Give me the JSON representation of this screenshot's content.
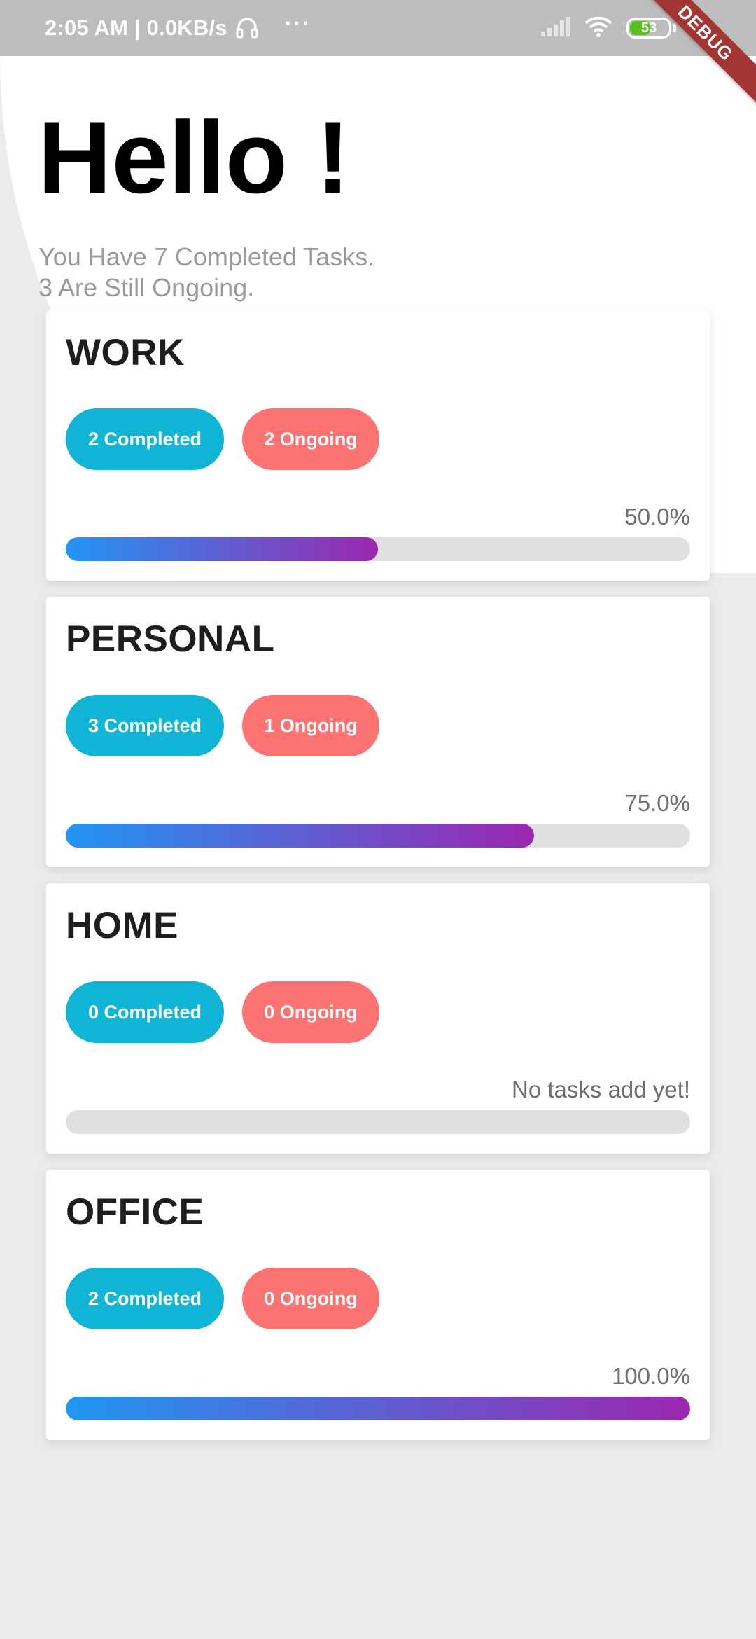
{
  "status_bar": {
    "time": "2:05 AM | 0.0KB/s",
    "battery": "53",
    "icons": [
      "headset-icon",
      "more-dots-icon",
      "signal-icon",
      "wifi-icon",
      "battery-icon",
      "charging-icon"
    ]
  },
  "debug_banner": "DEBUG",
  "greeting": {
    "title": "Hello !",
    "line1": "You Have 7 Completed Tasks.",
    "line2": "3 Are Still Ongoing."
  },
  "colors": {
    "completed": "#10b5d6",
    "ongoing": "#fc7372",
    "gradient_start": "#2196f3",
    "gradient_end": "#9c27b0",
    "track": "#e0e0e0"
  },
  "categories": [
    {
      "title": "WORK",
      "completed": "2 Completed",
      "ongoing": "2 Ongoing",
      "progress_label": "50.0%",
      "progress": 0.5
    },
    {
      "title": "PERSONAL",
      "completed": "3 Completed",
      "ongoing": "1 Ongoing",
      "progress_label": "75.0%",
      "progress": 0.75
    },
    {
      "title": "HOME",
      "completed": "0 Completed",
      "ongoing": "0 Ongoing",
      "progress_label": "No tasks add yet!",
      "progress": 0
    },
    {
      "title": "OFFICE",
      "completed": "2 Completed",
      "ongoing": "0 Ongoing",
      "progress_label": "100.0%",
      "progress": 1.0
    }
  ]
}
